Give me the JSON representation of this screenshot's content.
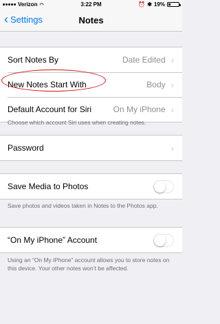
{
  "status_bar": {
    "carrier": "Verizon",
    "time": "3:22 PM",
    "battery_percent": "19%",
    "battery_level": 0.19
  },
  "nav": {
    "back_label": "Settings",
    "title": "Notes"
  },
  "settings": {
    "sort": {
      "label": "Sort Notes By",
      "value": "Date Edited"
    },
    "new_notes": {
      "label": "New Notes Start With",
      "value": "Body"
    },
    "siri_account": {
      "label": "Default Account for Siri",
      "value": "On My iPhone"
    },
    "siri_footer": "Choose which account Siri uses when creating notes.",
    "password": {
      "label": "Password"
    },
    "save_media": {
      "label": "Save Media to Photos",
      "enabled": false
    },
    "save_media_footer": "Save photos and videos taken in Notes to the Photos app.",
    "on_my_iphone": {
      "label": "“On My iPhone” Account",
      "enabled": false
    },
    "on_my_iphone_footer": "Using an “On My iPhone” account allows you to store notes on this device. Your other notes won’t be affected."
  }
}
